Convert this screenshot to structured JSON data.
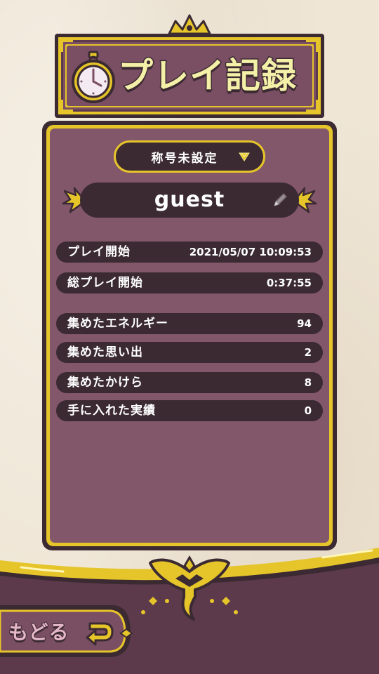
{
  "header": {
    "title": "プレイ記録"
  },
  "profile": {
    "title_selector": "称号未設定",
    "player_name": "guest"
  },
  "stats": [
    {
      "label": "プレイ開始",
      "value": "2021/05/07 10:09:53"
    },
    {
      "label": "総プレイ開始",
      "value": "0:37:55"
    },
    {
      "label": "集めたエネルギー",
      "value": "94"
    },
    {
      "label": "集めた思い出",
      "value": "2"
    },
    {
      "label": "集めたかけら",
      "value": "8"
    },
    {
      "label": "手に入れた実績",
      "value": "0"
    }
  ],
  "footer": {
    "back_label": "もどる"
  },
  "colors": {
    "dark": "#3b2a32",
    "panel": "#825769",
    "gold": "#e6c52a",
    "cream": "#efe6d6"
  }
}
